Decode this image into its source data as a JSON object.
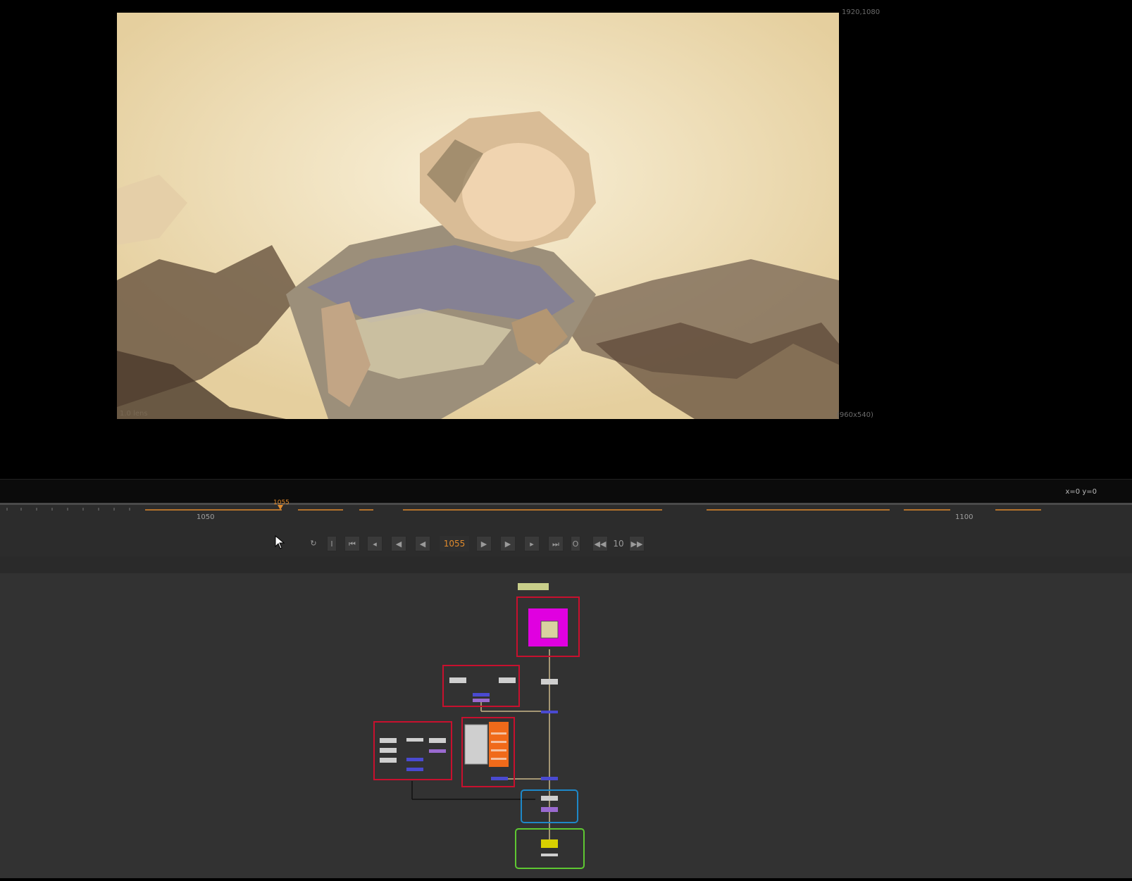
{
  "viewer": {
    "top_right_label": "1920,1080",
    "bottom_right_label": "(960x540)",
    "bottom_left_label": "1.0 lens"
  },
  "statusbar": {
    "coords": "x=0 y=0"
  },
  "timeline": {
    "tick_labels": [
      "1050",
      "1100"
    ],
    "playhead_label": "1055",
    "current_frame": "1055",
    "increment": "10"
  },
  "colors": {
    "accent_orange": "#e08a2c",
    "backdrop_red": "#c8102e",
    "backdrop_blue": "#1e88c8",
    "backdrop_green": "#5ec832",
    "read_node_magenta": "#e000e0"
  }
}
